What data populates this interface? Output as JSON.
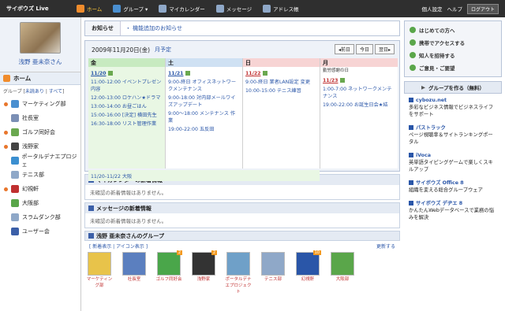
{
  "topbar": {
    "logo": "サイボウズ Live",
    "nav": [
      "ホーム",
      "グループ ▾",
      "マイカレンダー",
      "メッセージ",
      "アドレス帳"
    ],
    "right": [
      "個人設定",
      "ヘルプ"
    ],
    "logout": "ログアウト"
  },
  "sidebar": {
    "user_name": "浅野 亜未奈さん",
    "home": "ホーム",
    "group_prefix": "グループ [",
    "unread": "未読あり",
    "all": "すべて",
    "group_suffix": "]",
    "groups": [
      {
        "name": "マーケティング部",
        "dot": true
      },
      {
        "name": "社長室",
        "dot": false
      },
      {
        "name": "ゴルフ同好会",
        "dot": true
      },
      {
        "name": "浅野家",
        "dot": true
      },
      {
        "name": "ポータルデナエプロジェ",
        "dot": false
      },
      {
        "name": "テニス部",
        "dot": false
      },
      {
        "name": "幻視軒",
        "dot": true
      },
      {
        "name": "大阪部",
        "dot": false
      },
      {
        "name": "スラムダンク部",
        "dot": false
      },
      {
        "name": "ユーザー会",
        "dot": false
      }
    ]
  },
  "notice": {
    "label": "お知らせ",
    "link": "・ 機能追加のお知らせ"
  },
  "calendar": {
    "title": "2009年11月20日(金)",
    "month_btn": "月予定",
    "nav": [
      "◂前日",
      "今日",
      "翌日▸"
    ],
    "days": [
      {
        "head": "金",
        "cls": "fri",
        "holiday": "",
        "date": "11/20",
        "events": [
          "11:00-12:00 イベントプレゼン内容",
          "12:00-13:00 ロケハン★ドラマ",
          "13:00-14:00 お昼ごはん",
          "15:00-16:00 [決定] 横田先生",
          "16:30-18:00 リスト管理作業"
        ]
      },
      {
        "head": "土",
        "cls": "sat",
        "holiday": "",
        "date": "11/21",
        "events": [
          "9:00-終日 オフィスネットワークメンテナンス",
          "9:00-18:00 対内部メールワイズアップデート",
          "9:00～18:00 メンテナンス 作業",
          "19:00-22:00 五反田"
        ]
      },
      {
        "head": "日",
        "cls": "sun",
        "holiday": "",
        "date": "11/22",
        "events": [
          "9:00-終日 業者LAN設定 変更",
          "10:00-15:00 テニス練習"
        ]
      },
      {
        "head": "月",
        "cls": "mon",
        "holiday": "勤労感謝の日",
        "date": "11/23",
        "events": [
          "1:00-7:00 ネットワークメンテナンス",
          "19:00-22:00 お誕生日会★結"
        ]
      }
    ],
    "multiday": "11/20-11/22 大阪"
  },
  "sections": [
    {
      "title": "マイカレンダーの新着情報",
      "body": "未確認の新着情報はありません。"
    },
    {
      "title": "メッセージの新着情報",
      "body": "未確認の新着情報はありません。"
    }
  ],
  "group_section": {
    "title": "浅野 亜未奈さんのグループ",
    "tabs_text": "[ 新着表示 | アイコン表示 ]",
    "update": "更新する",
    "icons": [
      {
        "name": "マーケティング部",
        "badge": ""
      },
      {
        "name": "社長室",
        "badge": ""
      },
      {
        "name": "ゴルフ同好会",
        "badge": "2"
      },
      {
        "name": "浅野家",
        "badge": "2"
      },
      {
        "name": "ポータルデナエプロジェクト",
        "badge": ""
      },
      {
        "name": "テニス部",
        "badge": ""
      },
      {
        "name": "幻視軒",
        "badge": "10"
      },
      {
        "name": "大阪部",
        "badge": ""
      }
    ]
  },
  "right": {
    "actions": [
      "はじめての方へ",
      "携帯でアクセスする",
      "知人を招待する",
      "ご意見・ご要望"
    ],
    "make_group": "グループを作る（無料）",
    "ads": [
      {
        "title": "cybozu.net",
        "text": "多彩なビジネス情報でビジネスライフをサポート"
      },
      {
        "title": "パストラック",
        "text": "ページ視聴率＆サイトランキングポータル"
      },
      {
        "title": "iVoca",
        "text": "英単語タイピングゲームで楽しくスキルアップ"
      },
      {
        "title": "サイボウズ Office 8",
        "text": "組織を変える総合グループウェア"
      },
      {
        "title": "サイボウズ デヂエ 8",
        "text": "かんたんWebデータベースで業務の悩みを解決"
      }
    ]
  }
}
